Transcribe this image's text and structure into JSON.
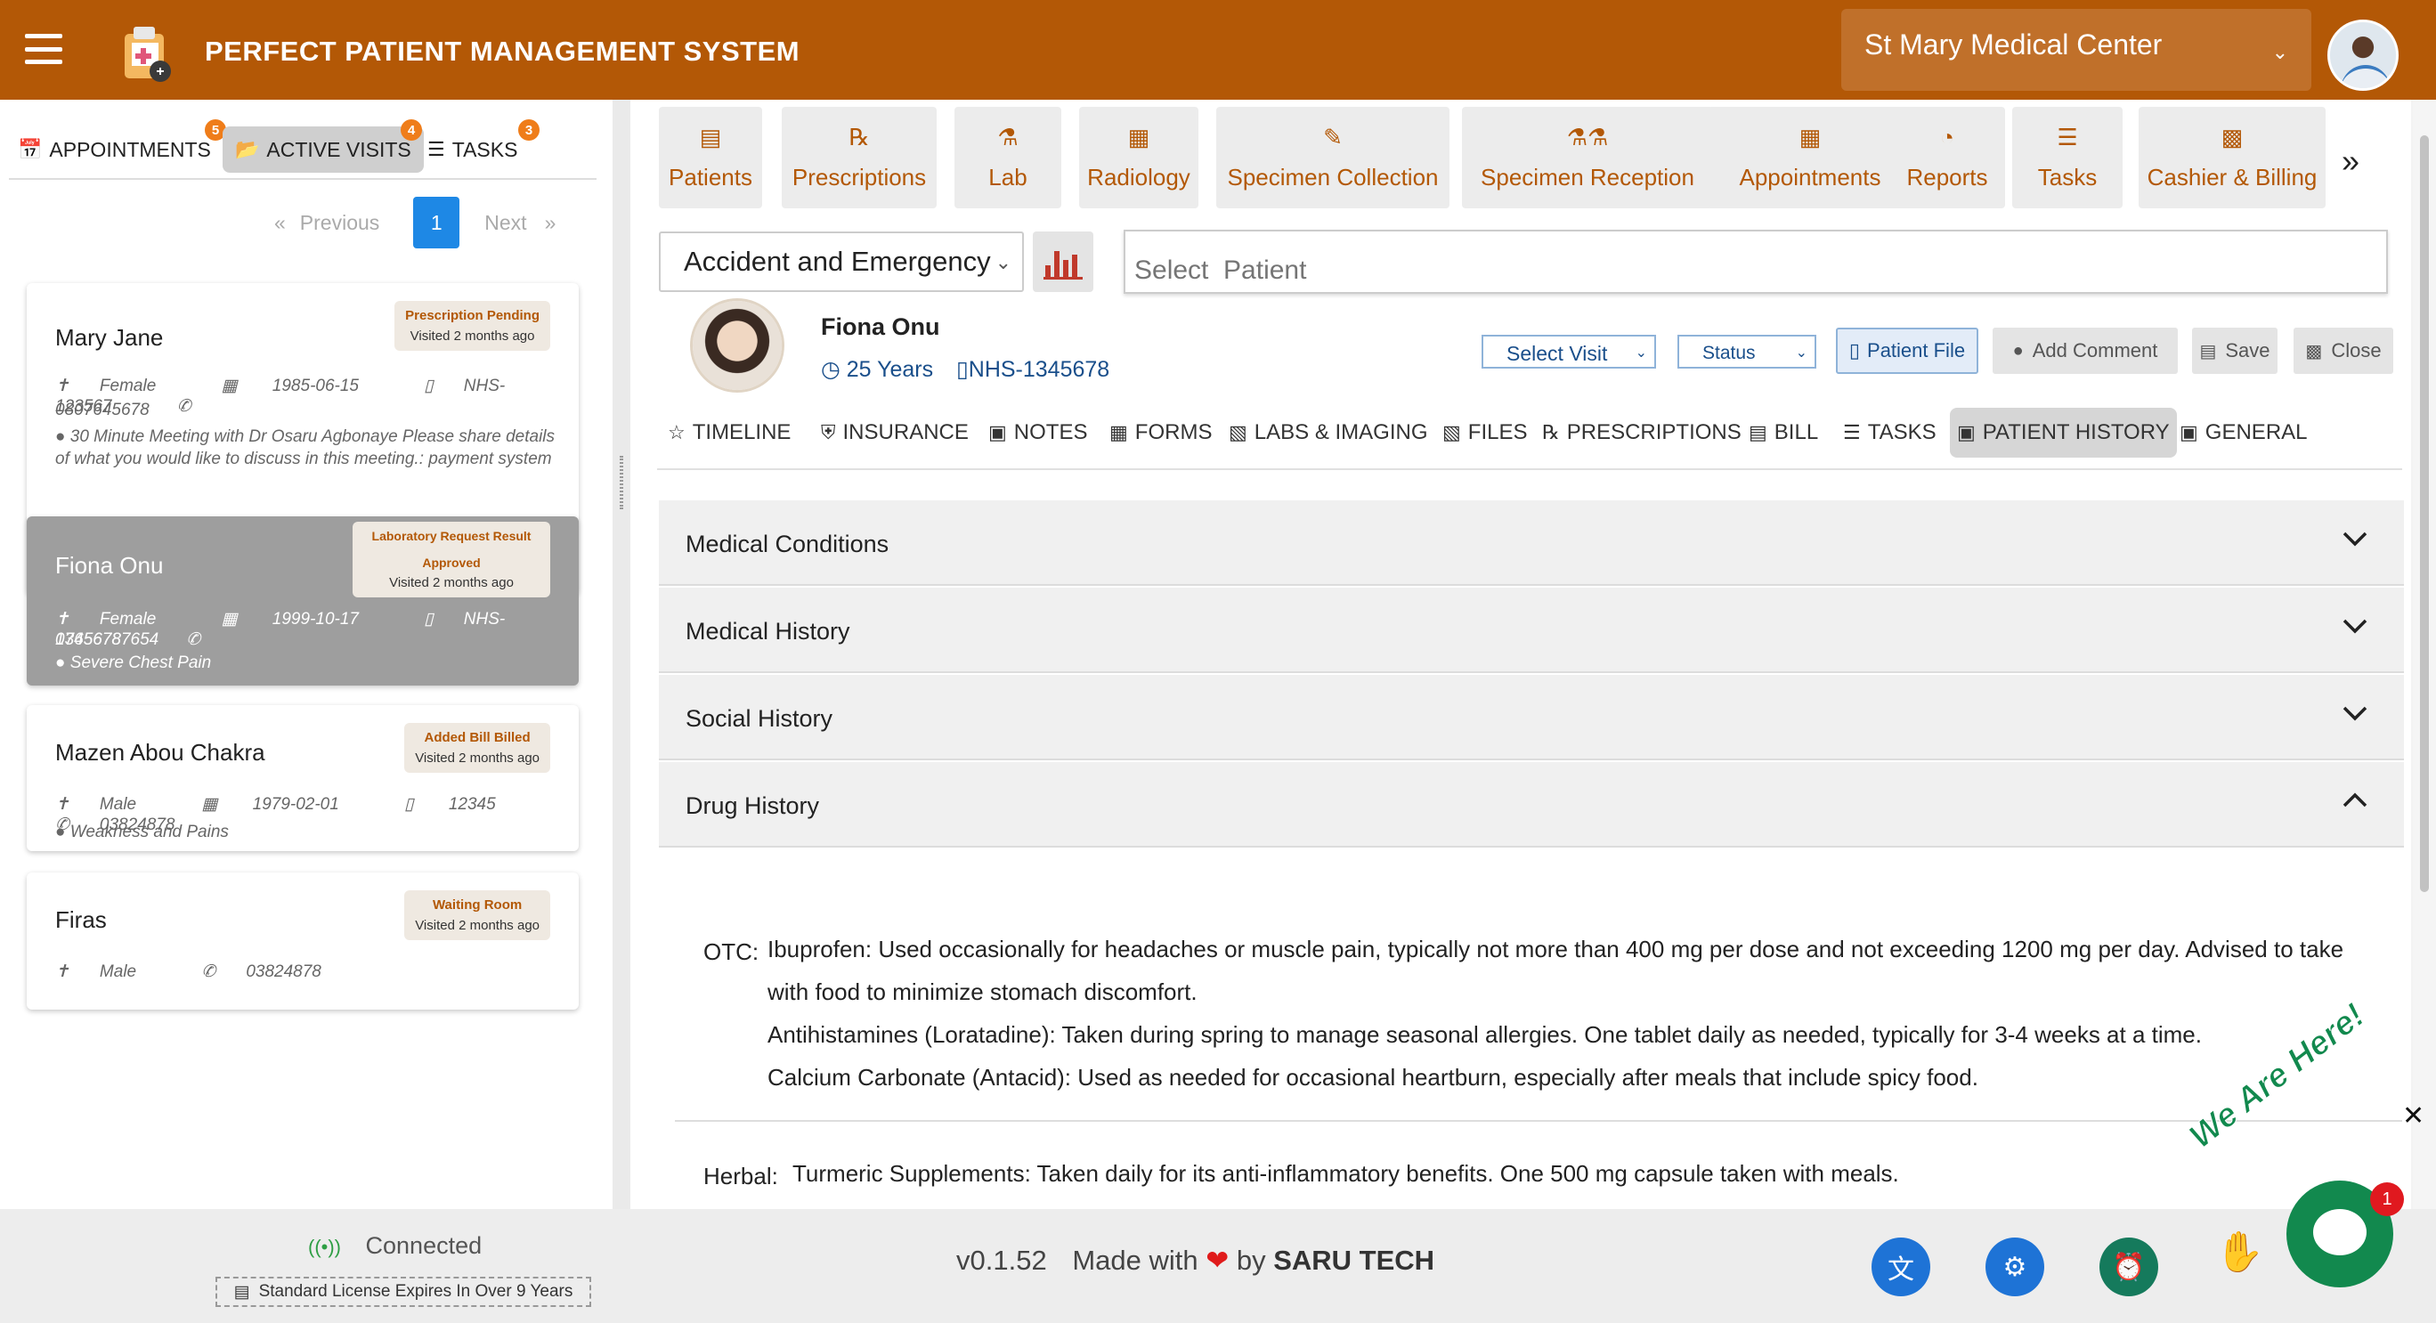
{
  "header": {
    "title": "PERFECT PATIENT MANAGEMENT SYSTEM",
    "facility": "St Mary Medical Center"
  },
  "left_tabs": [
    {
      "label": "APPOINTMENTS",
      "badge": "5",
      "icon": "calendar-icon"
    },
    {
      "label": "ACTIVE VISITS",
      "badge": "4",
      "icon": "folder-open-icon"
    },
    {
      "label": "TASKS",
      "badge": "3",
      "icon": "tasks-icon"
    }
  ],
  "pager": {
    "prev": "Previous",
    "page": "1",
    "next": "Next"
  },
  "visits": [
    {
      "name": "Mary Jane",
      "status": "Prescription Pending",
      "visited": "Visited 2 months ago",
      "gender": "Female",
      "dob": "1985-06-15",
      "nhs": "NHS-123567",
      "phone": "0807645678",
      "note": "30 Minute Meeting with Dr Osaru Agbonaye Please share details of what you would like to discuss in this meeting.: payment system"
    },
    {
      "name": "Fiona Onu",
      "status_line1": "Laboratory Request Result",
      "status_line2": "Approved",
      "visited": "Visited 2 months ago",
      "gender": "Female",
      "dob": "1999-10-17",
      "nhs": "NHS-1345678",
      "phone": "07656787654",
      "note": "Severe Chest Pain"
    },
    {
      "name": "Mazen Abou Chakra",
      "status": "Added Bill Billed",
      "visited": "Visited 2 months ago",
      "gender": "Male",
      "dob": "1979-02-01",
      "nhs": "12345",
      "phone": "03824878",
      "note": "Weakness and Pains"
    },
    {
      "name": "Firas",
      "status": "Waiting Room",
      "visited": "Visited 2 months ago",
      "gender": "Male",
      "phone": "03824878"
    }
  ],
  "modules": [
    {
      "label": "Patients",
      "icon": "id-card-icon"
    },
    {
      "label": "Prescriptions",
      "icon": "rx-icon"
    },
    {
      "label": "Lab",
      "icon": "flask-icon"
    },
    {
      "label": "Radiology",
      "icon": "radiology-icon"
    },
    {
      "label": "Specimen Collection",
      "icon": "syringe-icon"
    },
    {
      "label": "Specimen Reception",
      "icon": "vials-icon"
    },
    {
      "label": "Appointments",
      "icon": "calendar-icon"
    },
    {
      "label": "Reports",
      "icon": "pie-chart-icon"
    },
    {
      "label": "Tasks",
      "icon": "tasks-icon"
    },
    {
      "label": "Cashier & Billing",
      "icon": "cash-register-icon"
    }
  ],
  "department": "Accident and Emergency",
  "patient_search": {
    "placeholder": "Select  Patient"
  },
  "patient": {
    "name": "Fiona Onu",
    "age": "25 Years",
    "nhs": "NHS-1345678"
  },
  "visit_controls": {
    "select_visit": "Select Visit",
    "status": "Status",
    "patient_file": "Patient File",
    "add_comment": "Add Comment",
    "save": "Save",
    "close": "Close"
  },
  "file_tabs": [
    {
      "label": "TIMELINE",
      "icon": "timeline-icon"
    },
    {
      "label": "INSURANCE",
      "icon": "shield-icon"
    },
    {
      "label": "NOTES",
      "icon": "notes-icon"
    },
    {
      "label": "FORMS",
      "icon": "form-icon"
    },
    {
      "label": "LABS & IMAGING",
      "icon": "lab-file-icon"
    },
    {
      "label": "FILES",
      "icon": "files-icon"
    },
    {
      "label": "PRESCRIPTIONS",
      "icon": "rx-icon"
    },
    {
      "label": "BILL",
      "icon": "cart-icon"
    },
    {
      "label": "TASKS",
      "icon": "tasks-icon"
    },
    {
      "label": "PATIENT HISTORY",
      "icon": "medical-file-icon"
    },
    {
      "label": "GENERAL",
      "icon": "general-icon"
    }
  ],
  "history_sections": [
    "Medical Conditions",
    "Medical History",
    "Social History",
    "Drug History"
  ],
  "drug_history": {
    "otc_label": "OTC:",
    "otc_lines": [
      "Ibuprofen: Used occasionally for headaches or muscle pain, typically not more than 400 mg per dose and not exceeding 1200 mg per day. Advised to take",
      "with food to minimize stomach discomfort.",
      "Antihistamines (Loratadine): Taken during spring to manage seasonal allergies. One tablet daily as needed, typically for 3-4 weeks at a time.",
      "Calcium Carbonate (Antacid): Used as needed for occasional heartburn, especially after meals that include spicy food."
    ],
    "herbal_label": "Herbal:",
    "herbal_lines": [
      "Turmeric Supplements: Taken daily for its anti-inflammatory benefits. One 500 mg capsule taken with meals."
    ]
  },
  "footer": {
    "connection": "Connected",
    "license": "Standard License Expires In Over 9 Years",
    "version": "v0.1.52",
    "made_with": "Made with",
    "by": "by",
    "company": "SARU TECH"
  },
  "chat": {
    "banner": "We Are Here!",
    "unread": "1"
  },
  "colors": {
    "brand": "#b35806",
    "accent_blue": "#1e88e5",
    "chat_green": "#12894e",
    "badge_orange": "#ef7d1a"
  }
}
